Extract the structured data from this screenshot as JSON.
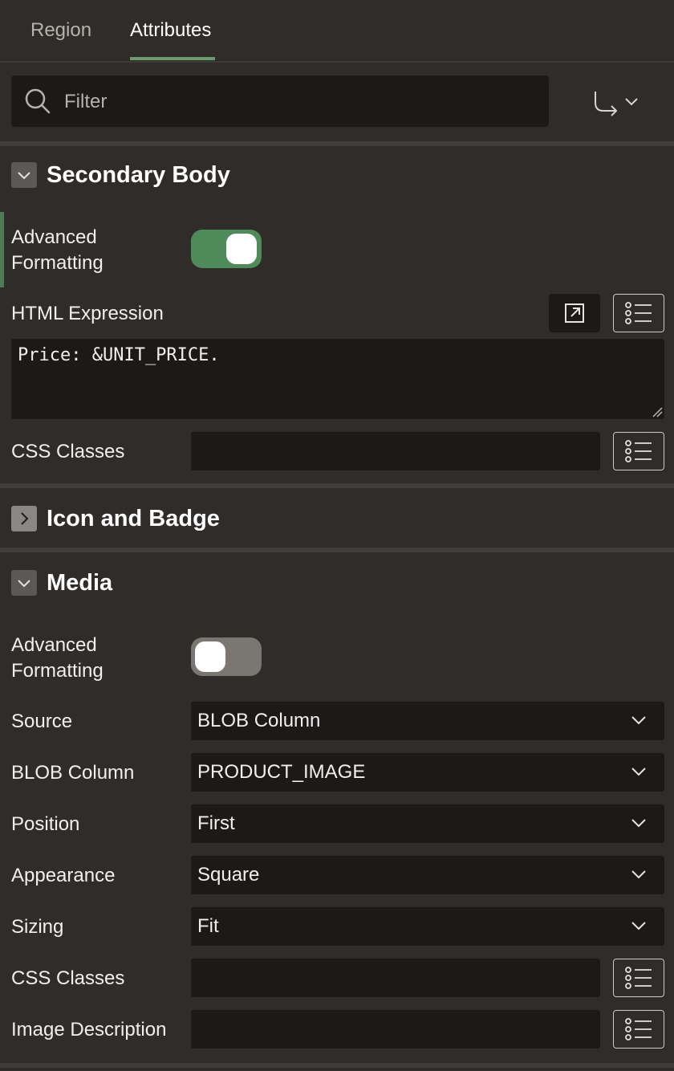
{
  "tabs": {
    "region": "Region",
    "attributes": "Attributes",
    "active": "Attributes"
  },
  "filter": {
    "placeholder": "Filter"
  },
  "secondary_body": {
    "title": "Secondary Body",
    "advanced_formatting_label": "Advanced Formatting",
    "advanced_formatting_on": true,
    "html_expression_label": "HTML Expression",
    "html_expression_value": "Price: &UNIT_PRICE.",
    "css_classes_label": "CSS Classes",
    "css_classes_value": ""
  },
  "icon_and_badge": {
    "title": "Icon and Badge",
    "expanded": false
  },
  "media": {
    "title": "Media",
    "advanced_formatting_label": "Advanced Formatting",
    "advanced_formatting_on": false,
    "source_label": "Source",
    "source_value": "BLOB Column",
    "blob_column_label": "BLOB Column",
    "blob_column_value": "PRODUCT_IMAGE",
    "position_label": "Position",
    "position_value": "First",
    "appearance_label": "Appearance",
    "appearance_value": "Square",
    "sizing_label": "Sizing",
    "sizing_value": "Fit",
    "css_classes_label": "CSS Classes",
    "css_classes_value": "",
    "image_description_label": "Image Description",
    "image_description_value": ""
  },
  "colors": {
    "background": "#2f2c2a",
    "field": "#1b1a19",
    "accent": "#4f8a5b",
    "tab_underline": "#6b9a6e"
  }
}
